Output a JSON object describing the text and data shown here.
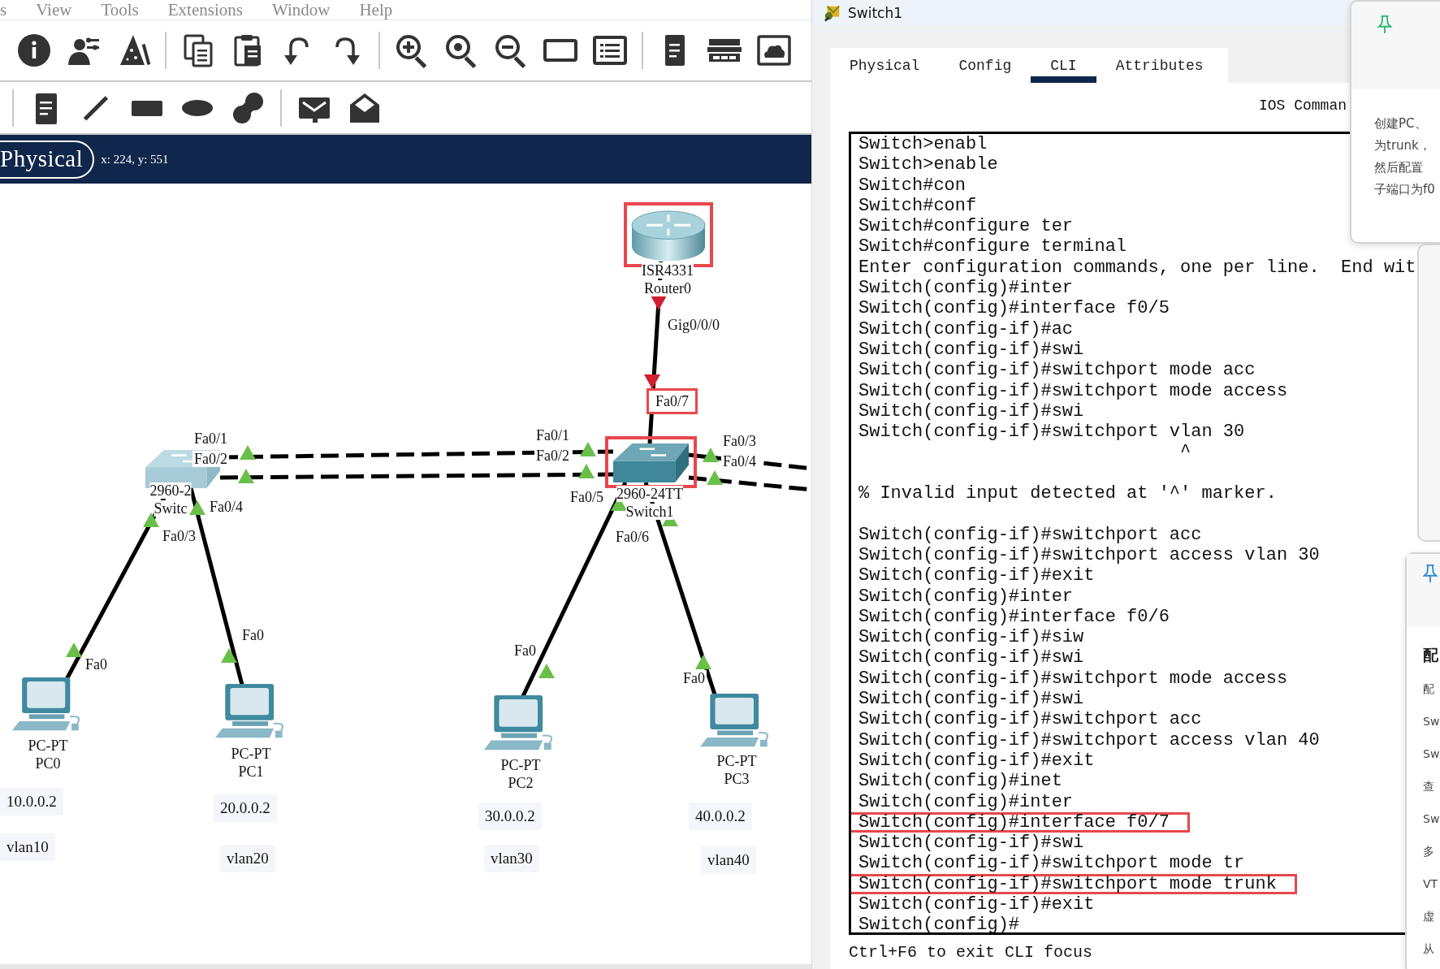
{
  "menu_bar": {
    "items": [
      "s",
      "View",
      "Tools",
      "Extensions",
      "Window",
      "Help"
    ]
  },
  "workspace_bar": {
    "tabs": [
      {
        "label": "Physical",
        "selected": true
      }
    ],
    "coordinates": "x: 224, y: 551"
  },
  "topology": {
    "devices": [
      {
        "kind": "router",
        "labels": [
          "ISR4331",
          "Router0"
        ],
        "highlighted": true
      },
      {
        "kind": "switch",
        "labels": [
          "2960-2",
          "Switc"
        ],
        "highlighted": false
      },
      {
        "kind": "switch",
        "labels": [
          "2960-24TT",
          "Switch1"
        ],
        "highlighted": true
      },
      {
        "kind": "pc",
        "labels": [
          "PC-PT",
          "PC0"
        ],
        "highlighted": false
      },
      {
        "kind": "pc",
        "labels": [
          "PC-PT",
          "PC1"
        ],
        "highlighted": false
      },
      {
        "kind": "pc",
        "labels": [
          "PC-PT",
          "PC2"
        ],
        "highlighted": false
      },
      {
        "kind": "pc",
        "labels": [
          "PC-PT",
          "PC3"
        ],
        "highlighted": false
      }
    ],
    "links": [
      {
        "kind": "straight"
      },
      {
        "kind": "crossover"
      },
      {
        "kind": "crossover"
      },
      {
        "kind": "crossover"
      },
      {
        "kind": "crossover"
      },
      {
        "kind": "straight"
      },
      {
        "kind": "straight"
      },
      {
        "kind": "straight"
      },
      {
        "kind": "straight"
      }
    ],
    "ports": [
      {
        "label": "Gig0/0/0",
        "up": false,
        "highlighted": false
      },
      {
        "label": "Fa0/7",
        "up": false,
        "highlighted": true
      },
      {
        "label": "Fa0/1",
        "up": true,
        "highlighted": false
      },
      {
        "label": "Fa0/2",
        "up": true,
        "highlighted": false
      },
      {
        "label": "Fa0/4",
        "up": true,
        "highlighted": false
      },
      {
        "label": "Fa0/3",
        "up": true,
        "highlighted": false
      },
      {
        "label": "Fa0/1",
        "up": true,
        "highlighted": false
      },
      {
        "label": "Fa0/2",
        "up": true,
        "highlighted": false
      },
      {
        "label": "Fa0/5",
        "up": true,
        "highlighted": false
      },
      {
        "label": "Fa0/6",
        "up": true,
        "highlighted": false
      },
      {
        "label": "Fa0/3",
        "up": true,
        "highlighted": false
      },
      {
        "label": "Fa0/4",
        "up": true,
        "highlighted": false
      },
      {
        "label": "Fa0",
        "up": true,
        "highlighted": false
      },
      {
        "label": "Fa0",
        "up": true,
        "highlighted": false
      },
      {
        "label": "Fa0",
        "up": true,
        "highlighted": false
      },
      {
        "label": "Fa0",
        "up": true,
        "highlighted": false
      }
    ],
    "notes": [
      "10.0.0.2",
      "vlan10",
      "20.0.0.2",
      "vlan20",
      "30.0.0.2",
      "vlan30",
      "40.0.0.2",
      "vlan40"
    ]
  },
  "device_window": {
    "title": "Switch1",
    "tabs": [
      {
        "label": "Physical",
        "selected": false
      },
      {
        "label": "Config",
        "selected": false
      },
      {
        "label": "CLI",
        "selected": true
      },
      {
        "label": "Attributes",
        "selected": false
      }
    ],
    "heading": "IOS Comman",
    "cli_lines": [
      {
        "kind": "text",
        "text": "Switch>enabl",
        "highlighted": false
      },
      {
        "kind": "text",
        "text": "Switch>enable",
        "highlighted": false
      },
      {
        "kind": "text",
        "text": "Switch#con",
        "highlighted": false
      },
      {
        "kind": "text",
        "text": "Switch#conf",
        "highlighted": false
      },
      {
        "kind": "text",
        "text": "Switch#configure ter",
        "highlighted": false
      },
      {
        "kind": "text",
        "text": "Switch#configure terminal",
        "highlighted": false
      },
      {
        "kind": "text",
        "text": "Enter configuration commands, one per line.  End wit",
        "highlighted": false
      },
      {
        "kind": "text",
        "text": "Switch(config)#inter",
        "highlighted": false
      },
      {
        "kind": "text",
        "text": "Switch(config)#interface f0/5",
        "highlighted": false
      },
      {
        "kind": "text",
        "text": "Switch(config-if)#ac",
        "highlighted": false
      },
      {
        "kind": "text",
        "text": "Switch(config-if)#swi",
        "highlighted": false
      },
      {
        "kind": "text",
        "text": "Switch(config-if)#switchport mode acc",
        "highlighted": false
      },
      {
        "kind": "text",
        "text": "Switch(config-if)#switchport mode access",
        "highlighted": false
      },
      {
        "kind": "text",
        "text": "Switch(config-if)#swi",
        "highlighted": false
      },
      {
        "kind": "text",
        "text": "Switch(config-if)#switchport vlan 30",
        "highlighted": false
      },
      {
        "kind": "text",
        "text": "                              ^",
        "highlighted": false
      },
      {
        "kind": "blank"
      },
      {
        "kind": "text",
        "text": "% Invalid input detected at '^' marker.",
        "highlighted": false
      },
      {
        "kind": "blank"
      },
      {
        "kind": "text",
        "text": "Switch(config-if)#switchport acc",
        "highlighted": false
      },
      {
        "kind": "text",
        "text": "Switch(config-if)#switchport access vlan 30",
        "highlighted": false
      },
      {
        "kind": "text",
        "text": "Switch(config-if)#exit",
        "highlighted": false
      },
      {
        "kind": "text",
        "text": "Switch(config)#inter",
        "highlighted": false
      },
      {
        "kind": "text",
        "text": "Switch(config)#interface f0/6",
        "highlighted": false
      },
      {
        "kind": "text",
        "text": "Switch(config-if)#siw",
        "highlighted": false
      },
      {
        "kind": "text",
        "text": "Switch(config-if)#swi",
        "highlighted": false
      },
      {
        "kind": "text",
        "text": "Switch(config-if)#switchport mode access",
        "highlighted": false
      },
      {
        "kind": "text",
        "text": "Switch(config-if)#swi",
        "highlighted": false
      },
      {
        "kind": "text",
        "text": "Switch(config-if)#switchport acc",
        "highlighted": false
      },
      {
        "kind": "text",
        "text": "Switch(config-if)#switchport access vlan 40",
        "highlighted": false
      },
      {
        "kind": "text",
        "text": "Switch(config-if)#exit",
        "highlighted": false
      },
      {
        "kind": "text",
        "text": "Switch(config)#inet",
        "highlighted": false
      },
      {
        "kind": "text",
        "text": "Switch(config)#inter",
        "highlighted": false
      },
      {
        "kind": "text",
        "text": "Switch(config)#interface f0/7",
        "highlighted": true
      },
      {
        "kind": "text",
        "text": "Switch(config-if)#swi",
        "highlighted": false
      },
      {
        "kind": "text",
        "text": "Switch(config-if)#switchport mode tr",
        "highlighted": false
      },
      {
        "kind": "text",
        "text": "Switch(config-if)#switchport mode trunk",
        "highlighted": true
      },
      {
        "kind": "text",
        "text": "Switch(config-if)#exit",
        "highlighted": false
      },
      {
        "kind": "text",
        "text": "Switch(config)#",
        "highlighted": false
      }
    ],
    "hint": "Ctrl+F6 to exit CLI focus"
  },
  "note_popup": {
    "lines": [
      "创建PC、",
      "为trunk，",
      "然后配置",
      "子端口为f0"
    ]
  },
  "side_panel": {
    "lines": [
      {
        "kind": "heading",
        "text": "配"
      },
      {
        "kind": "text",
        "text": "配"
      },
      {
        "kind": "text",
        "text": "Sw"
      },
      {
        "kind": "text",
        "text": "Sw"
      },
      {
        "kind": "text",
        "text": "查"
      },
      {
        "kind": "text",
        "text": "Sw"
      },
      {
        "kind": "text",
        "text": "多"
      },
      {
        "kind": "text",
        "text": "VT"
      },
      {
        "kind": "text",
        "text": "虚"
      },
      {
        "kind": "text",
        "text": "从"
      }
    ]
  }
}
